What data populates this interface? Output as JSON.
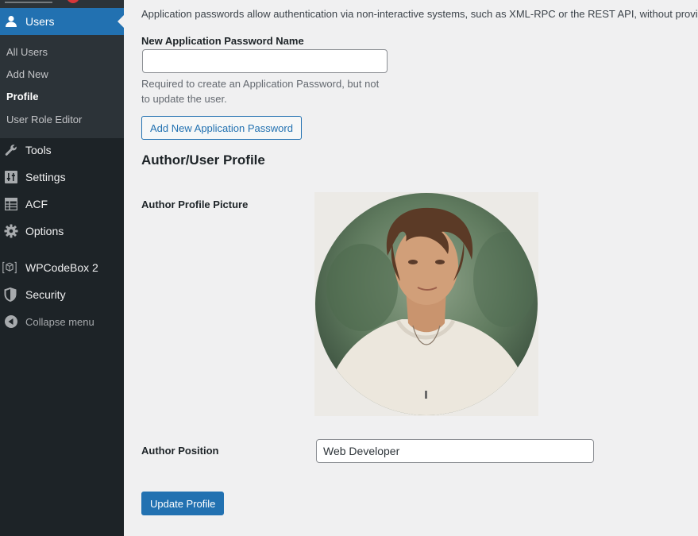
{
  "sidebar": {
    "current_menu": {
      "label": "Users",
      "icon": "user-icon"
    },
    "submenu": [
      {
        "label": "All Users"
      },
      {
        "label": "Add New"
      },
      {
        "label": "Profile",
        "current": true
      },
      {
        "label": "User Role Editor"
      }
    ],
    "menu": [
      {
        "label": "Tools",
        "icon": "wrench-icon"
      },
      {
        "label": "Settings",
        "icon": "settings-sliders-icon"
      },
      {
        "label": "ACF",
        "icon": "acf-table-icon"
      },
      {
        "label": "Options",
        "icon": "gear-icon"
      },
      {
        "label": "WPCodeBox 2",
        "icon": "code-box-icon"
      },
      {
        "label": "Security",
        "icon": "shield-icon"
      },
      {
        "label": "Collapse menu",
        "icon": "collapse-arrow-icon"
      }
    ]
  },
  "app_passwords": {
    "intro": "Application passwords allow authentication via non-interactive systems, such as XML-RPC or the REST API, without providing",
    "name_label": "New Application Password Name",
    "name_value": "",
    "description": "Required to create an Application Password, but not to update the user.",
    "add_button": "Add New Application Password"
  },
  "author_profile": {
    "title": "Author/User Profile",
    "picture_label": "Author Profile Picture",
    "position_label": "Author Position",
    "position_value": "Web Developer"
  },
  "update_button": "Update Profile",
  "colors": {
    "sidebar_bg": "#1d2327",
    "submenu_bg": "#2c3338",
    "accent": "#2271b1",
    "page_bg": "#f0f0f1"
  }
}
